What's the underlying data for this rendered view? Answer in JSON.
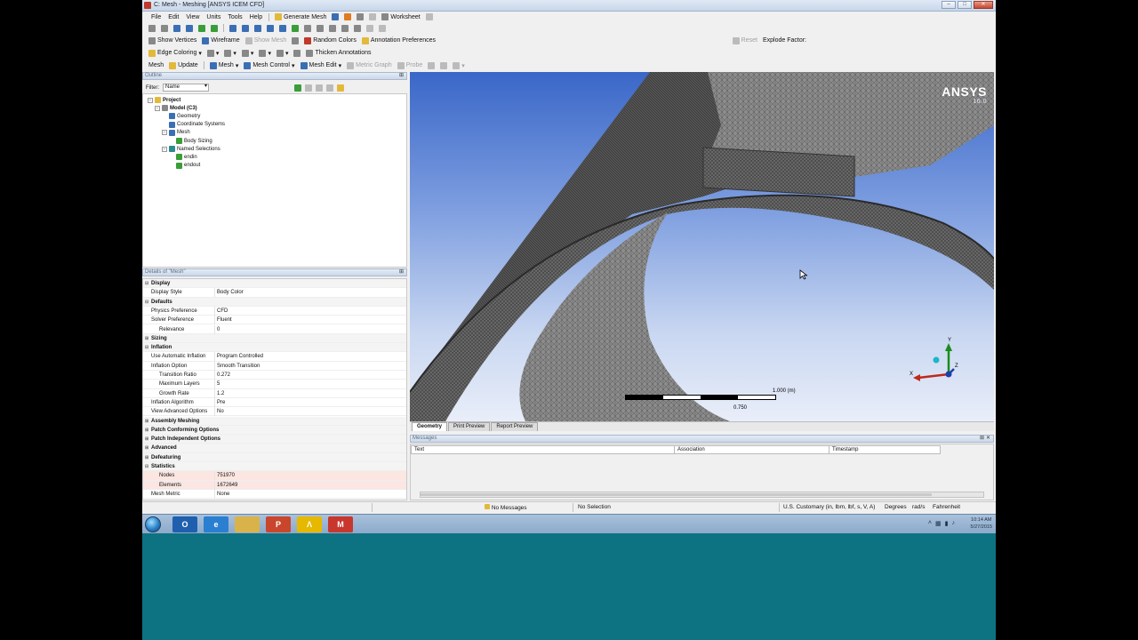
{
  "window": {
    "title": "C: Mesh - Meshing [ANSYS ICEM CFD]",
    "btn_min": "–",
    "btn_max": "□",
    "btn_close": "✕"
  },
  "menu": [
    "File",
    "Edit",
    "View",
    "Units",
    "Tools",
    "Help"
  ],
  "toolbar1": {
    "generate_mesh": "Generate Mesh",
    "worksheet": "Worksheet"
  },
  "toolbar2": {
    "show_vertices": "Show Vertices",
    "wireframe": "Wireframe",
    "show_mesh": "Show Mesh",
    "random_colors": "Random Colors",
    "annotation_prefs": "Annotation Preferences",
    "reset": "Reset",
    "explode_factor": "Explode Factor:"
  },
  "toolbar3": {
    "edge_coloring": "Edge Coloring",
    "thicken_annotations": "Thicken Annotations"
  },
  "toolbar4": {
    "mesh": "Mesh",
    "update": "Update",
    "mesh_dd": "Mesh",
    "mesh_control": "Mesh Control",
    "mesh_edit": "Mesh Edit",
    "metric_graph": "Metric Graph",
    "probe": "Probe"
  },
  "outline": {
    "header": "Outline",
    "filter_label": "Filter:",
    "filter_value": "Name",
    "nodes": [
      {
        "label": "Project",
        "level": 0,
        "icon": "project-icon"
      },
      {
        "label": "Model (C3)",
        "level": 1,
        "icon": "model-icon"
      },
      {
        "label": "Geometry",
        "level": 2,
        "icon": "geometry-icon"
      },
      {
        "label": "Coordinate Systems",
        "level": 2,
        "icon": "coordinate-systems-icon"
      },
      {
        "label": "Mesh",
        "level": 2,
        "icon": "mesh-icon"
      },
      {
        "label": "Body Sizing",
        "level": 3,
        "icon": "body-sizing-icon"
      },
      {
        "label": "Named Selections",
        "level": 2,
        "icon": "named-selections-icon"
      },
      {
        "label": "endin",
        "level": 3,
        "icon": "named-selection-icon"
      },
      {
        "label": "endout",
        "level": 3,
        "icon": "named-selection-icon"
      }
    ]
  },
  "details": {
    "header": "Details of \"Mesh\"",
    "rows": [
      {
        "type": "cat",
        "label": "Display",
        "tog": "⊟"
      },
      {
        "type": "prop",
        "label": "Display Style",
        "value": "Body Color"
      },
      {
        "type": "cat",
        "label": "Defaults",
        "tog": "⊟"
      },
      {
        "type": "prop",
        "label": "Physics Preference",
        "value": "CFD"
      },
      {
        "type": "prop",
        "label": "Solver Preference",
        "value": "Fluent"
      },
      {
        "type": "prop",
        "label": "Relevance",
        "value": "0",
        "indent": true
      },
      {
        "type": "cat",
        "label": "Sizing",
        "tog": "⊞"
      },
      {
        "type": "cat",
        "label": "Inflation",
        "tog": "⊟"
      },
      {
        "type": "prop",
        "label": "Use Automatic Inflation",
        "value": "Program Controlled"
      },
      {
        "type": "prop",
        "label": "Inflation Option",
        "value": "Smooth Transition"
      },
      {
        "type": "prop",
        "label": "Transition Ratio",
        "value": "0.272",
        "indent": true
      },
      {
        "type": "prop",
        "label": "Maximum Layers",
        "value": "5",
        "indent": true
      },
      {
        "type": "prop",
        "label": "Growth Rate",
        "value": "1.2",
        "indent": true
      },
      {
        "type": "prop",
        "label": "Inflation Algorithm",
        "value": "Pre"
      },
      {
        "type": "prop",
        "label": "View Advanced Options",
        "value": "No"
      },
      {
        "type": "cat",
        "label": "Assembly Meshing",
        "tog": "⊞"
      },
      {
        "type": "cat",
        "label": "Patch Conforming Options",
        "tog": "⊞"
      },
      {
        "type": "cat",
        "label": "Patch Independent Options",
        "tog": "⊞"
      },
      {
        "type": "cat",
        "label": "Advanced",
        "tog": "⊞"
      },
      {
        "type": "cat",
        "label": "Defeaturing",
        "tog": "⊞"
      },
      {
        "type": "cat",
        "label": "Statistics",
        "tog": "⊟"
      },
      {
        "type": "stat",
        "label": "Nodes",
        "value": "751970",
        "indent": true
      },
      {
        "type": "stat",
        "label": "Elements",
        "value": "1672649",
        "indent": true
      },
      {
        "type": "prop",
        "label": "Mesh Metric",
        "value": "None"
      }
    ]
  },
  "viewport": {
    "logo": "ANSYS",
    "version": "16.0",
    "scale_max": "1.000 (m)",
    "scale_mid": "0.750",
    "axis_y": "Y",
    "axis_z": "Z",
    "axis_x": "X",
    "tabs": [
      "Geometry",
      "Print Preview",
      "Report Preview"
    ]
  },
  "messages": {
    "header": "Messages",
    "columns": [
      "Text",
      "Association",
      "Timestamp"
    ]
  },
  "status": {
    "messages": "No Messages",
    "selection": "No Selection",
    "units": "U.S. Customary (in, lbm, lbf, s, V, A)",
    "angle": "Degrees",
    "rate": "rad/s",
    "temp": "Fahrenheit"
  },
  "taskbar": {
    "apps": [
      {
        "name": "outlook",
        "label": "O",
        "color": "#1f5fae"
      },
      {
        "name": "ie",
        "label": "e",
        "color": "#2b7fd1"
      },
      {
        "name": "explorer",
        "label": "",
        "color": "#d9b34a"
      },
      {
        "name": "powerpoint",
        "label": "P",
        "color": "#c9462c"
      },
      {
        "name": "ansys",
        "label": "Λ",
        "color": "#e6b800"
      },
      {
        "name": "gmail",
        "label": "M",
        "color": "#c8372d"
      }
    ],
    "time": "10:14 AM",
    "date": "5/27/2015"
  },
  "colors": {
    "desktop": "#0d7383",
    "sky_top": "#3a67c8",
    "sky_bottom": "#e9eef9",
    "mesh": "#5e5e5e"
  }
}
